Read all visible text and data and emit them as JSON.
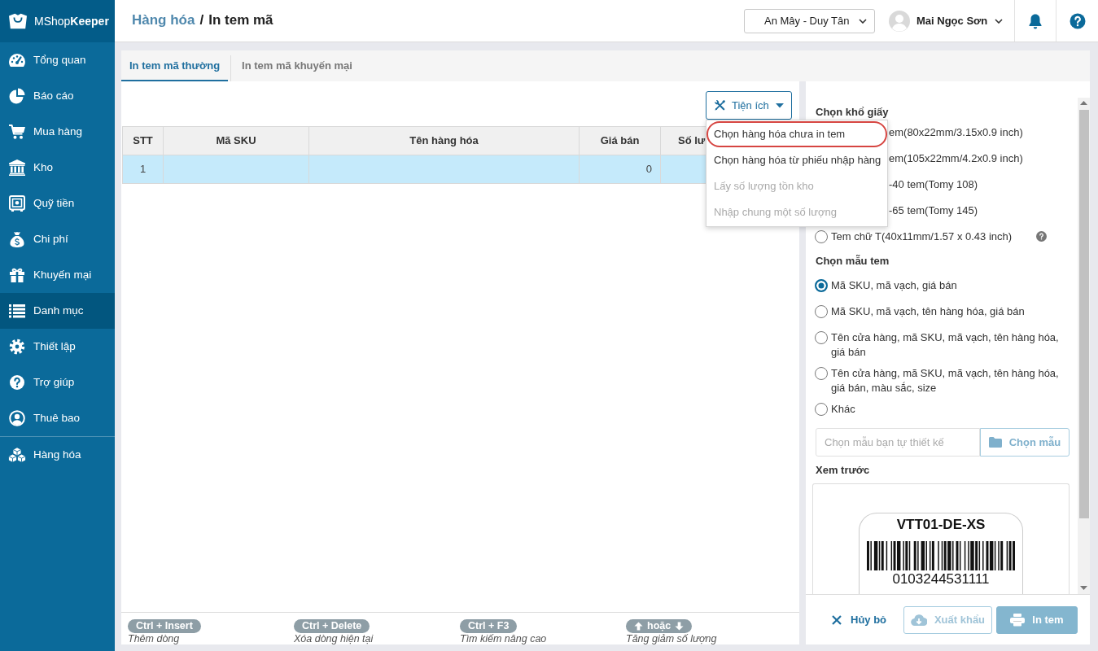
{
  "sidebar": {
    "logo": "MShop**Keeper**",
    "items": [
      {
        "label": "Tổng quan",
        "selected": false
      },
      {
        "label": "Báo cáo",
        "selected": false
      },
      {
        "label": "Mua hàng",
        "selected": false
      },
      {
        "label": "Kho",
        "selected": false
      },
      {
        "label": "Quỹ tiền",
        "selected": false
      },
      {
        "label": "Chi phí",
        "selected": false
      },
      {
        "label": "Khuyến mại",
        "selected": false
      },
      {
        "label": "Danh mục",
        "selected": true
      },
      {
        "label": "Thiết lập",
        "selected": false
      },
      {
        "label": "Trợ giúp",
        "selected": false
      },
      {
        "label": "Thuê bao",
        "selected": false
      }
    ],
    "extra_items": [
      {
        "label": "Hàng hóa",
        "selected": false
      }
    ]
  },
  "header": {
    "breadcrumb": "Hàng hóa",
    "separator": "/",
    "title": "In tem mã",
    "store": "An Mây - Duy Tân",
    "user": "Mai Ngọc Sơn"
  },
  "tabs": [
    {
      "label": "In tem mã thường",
      "selected": true
    },
    {
      "label": "In tem mã khuyến mại",
      "selected": false
    }
  ],
  "toolbar": {
    "utility_button": {
      "label": "Tiện ích",
      "expanded": true
    },
    "menu": [
      {
        "label": "Chọn hàng hóa chưa in tem",
        "disabled": false,
        "highlighted": true
      },
      {
        "label": "Chọn hàng hóa từ phiếu nhập hàng",
        "disabled": false,
        "highlighted": false
      },
      {
        "label": "Lấy số lượng tồn kho",
        "disabled": true,
        "highlighted": false
      },
      {
        "label": "Nhập chung một số lượng",
        "disabled": true,
        "highlighted": false
      }
    ]
  },
  "table": {
    "columns": [
      "STT",
      "Mã SKU",
      "Tên hàng hóa",
      "Giá bán",
      "Số lư"
    ],
    "rows": [
      {
        "selected": true,
        "cells": [
          "1",
          null,
          null,
          "0",
          null
        ]
      }
    ]
  },
  "shortcuts": [
    {
      "kind": "text",
      "keys": "Ctrl + Insert",
      "description": "Thêm dòng"
    },
    {
      "kind": "text",
      "keys": "Ctrl + Delete",
      "description": "Xóa dòng hiện tại"
    },
    {
      "kind": "text",
      "keys": "Ctrl + F3",
      "description": "Tìm kiếm nâng cao"
    },
    {
      "kind": "arrows",
      "keys": "hoặc",
      "description": "Tăng giảm số lượng"
    }
  ],
  "settings": {
    "paper_title": "Chọn khổ giấy",
    "paper_sizes": [
      {
        "label": "em(80x22mm/3.15x0.9 inch)",
        "covered": true
      },
      {
        "label": "em(105x22mm/4.2x0.9 inch)",
        "covered": true
      },
      {
        "label": "-40 tem(Tomy 108)",
        "covered": true
      },
      {
        "label": "-65 tem(Tomy 145)",
        "covered": true
      },
      {
        "label": "Tem chữ T(40x11mm/1.57 x 0.43 inch)",
        "covered": false,
        "selected": false,
        "help": true
      }
    ],
    "template_title": "Chọn mẫu tem",
    "templates": [
      {
        "label": "Mã SKU, mã vạch, giá bán",
        "selected": true
      },
      {
        "label": "Mã SKU, mã vạch, tên hàng hóa, giá bán",
        "selected": false
      },
      {
        "label": "Tên cửa hàng, mã SKU, mã vạch, tên hàng hóa, giá bán",
        "selected": false
      },
      {
        "label": "Tên cửa hàng, mã SKU, mã vạch, tên hàng hóa, giá bán, màu sắc, size",
        "selected": false
      },
      {
        "label": "Khác",
        "selected": false
      }
    ],
    "custom_template": {
      "placeholder": "Chọn mẫu bạn tự thiết kế",
      "button": "Chọn mẫu",
      "disabled": true
    },
    "preview_title": "Xem trước",
    "preview": {
      "code": "VTT01-DE-XS",
      "number": "0103244531111"
    }
  },
  "footer": {
    "cancel": "Hủy bỏ",
    "export": {
      "label": "Xuất khẩu",
      "disabled": true
    },
    "print": {
      "label": "In tem",
      "disabled": true
    }
  }
}
